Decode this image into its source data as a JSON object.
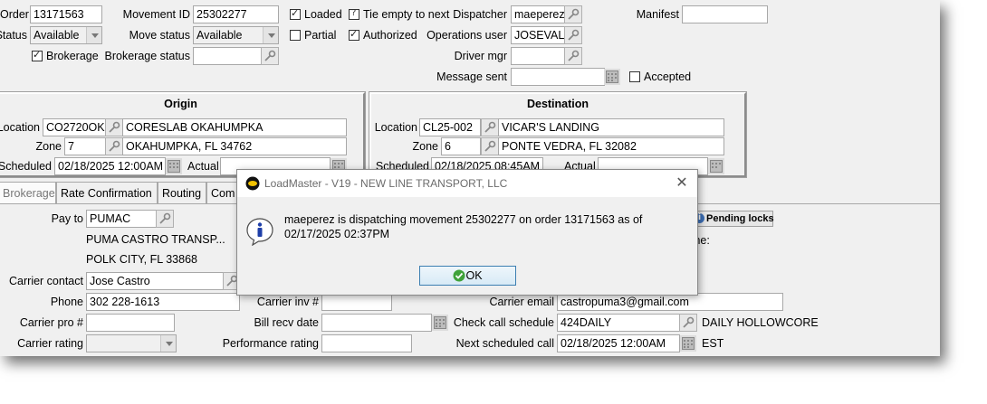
{
  "header": {
    "order_label": "Order",
    "order_value": "13171563",
    "status_label": "Status",
    "status_value": "Available",
    "movement_id_label": "Movement ID",
    "movement_id_value": "25302277",
    "move_status_label": "Move status",
    "move_status_value": "Available",
    "brokerage_label": "Brokerage",
    "brokerage_status_label": "Brokerage status",
    "brokerage_status_value": "",
    "loaded_label": "Loaded",
    "partial_label": "Partial",
    "tie_empty_label": "Tie empty to next",
    "authorized_label": "Authorized",
    "dispatcher_label": "Dispatcher",
    "dispatcher_value": "maeperez",
    "operations_user_label": "Operations user",
    "operations_user_value": "JOSEVALD",
    "driver_mgr_label": "Driver mgr",
    "driver_mgr_value": "",
    "message_sent_label": "Message sent",
    "message_sent_value": "",
    "accepted_label": "Accepted",
    "manifest_label": "Manifest",
    "manifest_value": ""
  },
  "origin": {
    "title": "Origin",
    "location_label": "Location",
    "location_code": "CO2720OK",
    "location_name": "CORESLAB OKAHUMPKA",
    "zone_label": "Zone",
    "zone_value": "7",
    "city_state": "OKAHUMPKA, FL 34762",
    "scheduled_label": "Scheduled",
    "scheduled_value": "02/18/2025 12:00AM",
    "actual_label": "Actual",
    "actual_value": ""
  },
  "destination": {
    "title": "Destination",
    "location_label": "Location",
    "location_code": "CL25-002",
    "location_name": "VICAR'S LANDING",
    "zone_label": "Zone",
    "zone_value": "6",
    "city_state": "PONTE VEDRA, FL 32082",
    "scheduled_label": "Scheduled",
    "scheduled_value": "02/18/2025 08:45AM",
    "actual_label": "Actual",
    "actual_value": ""
  },
  "tabs": [
    "Brokerage",
    "Rate Confirmation",
    "Routing",
    "Com"
  ],
  "brokerage": {
    "pay_to_label": "Pay to",
    "pay_to_value": "PUMAC",
    "carrier_name": "PUMA CASTRO TRANSP...",
    "carrier_city": "POLK CITY, FL 33868",
    "carrier_contact_label": "Carrier contact",
    "carrier_contact_value": "Jose Castro",
    "phone_label": "Phone",
    "phone_value": "302 228-1613",
    "carrier_pro_label": "Carrier pro #",
    "carrier_pro_value": "",
    "carrier_rating_label": "Carrier rating",
    "carrier_rating_value": "",
    "carrier_inv_label": "Carrier inv #",
    "carrier_inv_value": "",
    "bill_recv_label": "Bill recv date",
    "bill_recv_value": "",
    "performance_rating_label": "Performance rating",
    "performance_rating_value": "",
    "pending_locks_label": "Pending locks",
    "partial_me_label": "me:",
    "carrier_email_label": "Carrier email",
    "carrier_email_value": "castropuma3@gmail.com",
    "check_call_label": "Check call schedule",
    "check_call_value": "424DAILY",
    "check_call_desc": "DAILY HOLLOWCORE",
    "next_call_label": "Next scheduled call",
    "next_call_value": "02/18/2025 12:00AM",
    "next_call_tz": "EST"
  },
  "dialog": {
    "title": "LoadMaster - V19 - NEW LINE TRANSPORT, LLC",
    "message": "maeperez is dispatching movement 25302277 on order 13171563 as of 02/17/2025 02:37PM",
    "ok_label": "OK",
    "icon": "info-icon"
  }
}
